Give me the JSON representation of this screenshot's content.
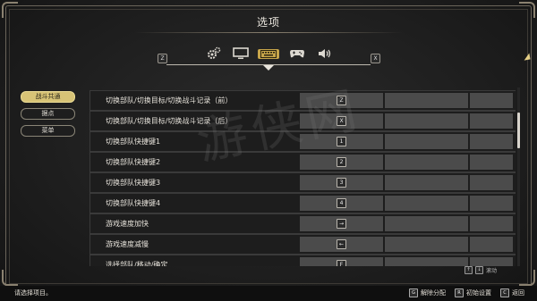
{
  "header": {
    "title": "选项",
    "key_left": "Z",
    "key_right": "X"
  },
  "tabs": [
    {
      "name": "gears-icon"
    },
    {
      "name": "monitor-icon"
    },
    {
      "name": "keyboard-icon",
      "active": true
    },
    {
      "name": "gamepad-icon"
    },
    {
      "name": "speaker-icon"
    }
  ],
  "side_menu": [
    {
      "label": "战斗共通",
      "active": true
    },
    {
      "label": "据点"
    },
    {
      "label": "菜单"
    }
  ],
  "rows": [
    {
      "label": "切换部队/切换目标/切换战斗记录（前）",
      "key": "Z"
    },
    {
      "label": "切换部队/切换目标/切换战斗记录（后）",
      "key": "X"
    },
    {
      "label": "切换部队快捷键1",
      "key": "1"
    },
    {
      "label": "切换部队快捷键2",
      "key": "2"
    },
    {
      "label": "切换部队快捷键3",
      "key": "3"
    },
    {
      "label": "切换部队快捷键4",
      "key": "4"
    },
    {
      "label": "游戏速度加快",
      "key": "→"
    },
    {
      "label": "游戏速度减慢",
      "key": "←"
    },
    {
      "label": "选择部队/移动/确定",
      "key": "F"
    }
  ],
  "scroll_hint": {
    "key_up": "↑",
    "key_down": "↓",
    "label": "滚动"
  },
  "watermark": "游侠网",
  "footer": {
    "status": "请选择项目。",
    "actions": [
      {
        "key": "G",
        "label": "解除分配"
      },
      {
        "key": "R",
        "label": "初始设置"
      },
      {
        "key": "C",
        "label": "返回"
      }
    ]
  },
  "colors": {
    "accent": "#d7c376",
    "tab_active": "#c8a64a",
    "row_bg": "#1d1d1d",
    "cell_bg": "#4b4b4b"
  }
}
